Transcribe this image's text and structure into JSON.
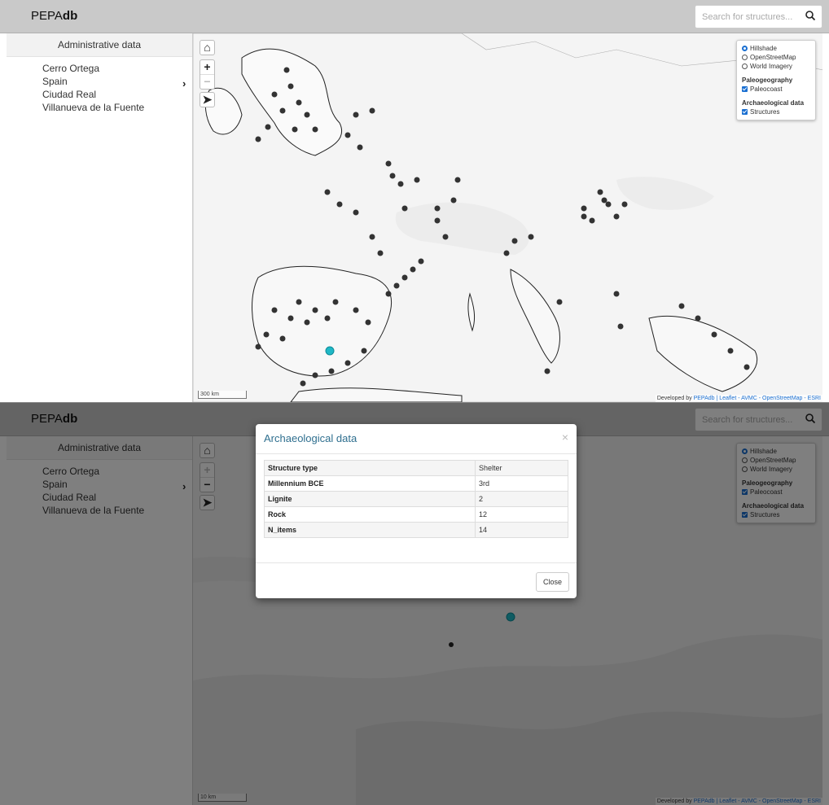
{
  "app": {
    "brand_prefix": "PEPA",
    "brand_suffix": "db"
  },
  "search": {
    "placeholder": "Search for structures..."
  },
  "sidebar": {
    "header": "Administrative data",
    "items": [
      "Cerro Ortega",
      "Spain",
      "Ciudad Real",
      "Villanueva de la Fuente"
    ]
  },
  "layers": {
    "base": [
      {
        "label": "Hillshade",
        "checked": true
      },
      {
        "label": "OpenStreetMap",
        "checked": false
      },
      {
        "label": "World Imagery",
        "checked": false
      }
    ],
    "paleo_header": "Paleogeography",
    "paleo_item": "Paleocoast",
    "arch_header": "Archaeological data",
    "arch_item": "Structures"
  },
  "top_map": {
    "scale": "300 km"
  },
  "bottom_map": {
    "scale": "10 km"
  },
  "attribution": {
    "prefix": "Developed by ",
    "links": "PEPAdb | Leaflet - AVMC - OpenStreetMap - ESRI"
  },
  "modal": {
    "title": "Archaeological data",
    "close_label": "Close",
    "rows": [
      {
        "key": "Structure type",
        "value": "Shelter"
      },
      {
        "key": "Millennium BCE",
        "value": "3rd"
      },
      {
        "key": "Lignite",
        "value": "2"
      },
      {
        "key": "Rock",
        "value": "12"
      },
      {
        "key": "N_items",
        "value": "14"
      }
    ]
  },
  "colors": {
    "accent": "#1a6fd1",
    "highlight": "#1fb8c6",
    "point": "#333333"
  }
}
